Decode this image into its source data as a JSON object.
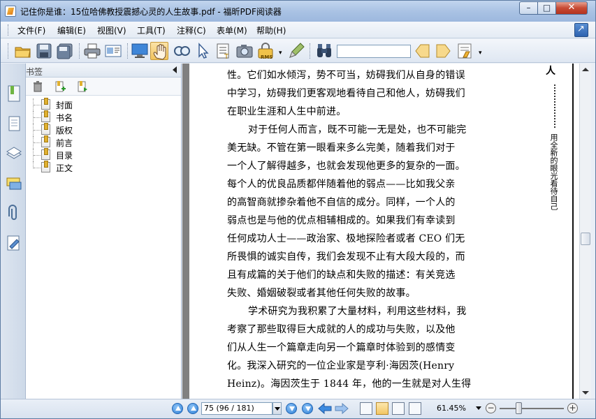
{
  "window": {
    "title": "记住你是谁：15位哈佛教授震撼心灵的人生故事.pdf - 福昕PDF阅读器",
    "min_label": "–",
    "max_label": "□",
    "close_label": "✕"
  },
  "menu": {
    "items": [
      "文件(F)",
      "编辑(E)",
      "视图(V)",
      "工具(T)",
      "注释(C)",
      "表单(M)",
      "帮助(H)"
    ]
  },
  "toolbar": {
    "icons": [
      "open-folder-icon",
      "save-icon",
      "save-as-icon",
      "print-icon",
      "properties-icon",
      "fullscreen-icon",
      "hand-tool-icon",
      "zoom-glass-icon",
      "select-arrow-icon",
      "text-select-icon",
      "snapshot-icon",
      "rms-icon",
      "edit-icon",
      "find-binoculars-icon",
      "find-prev-icon",
      "find-next-icon",
      "highlight-icon"
    ],
    "rms_label": "RMS",
    "find_value": ""
  },
  "bookmarks": {
    "title": "书签",
    "items": [
      "封面",
      "书名",
      "版权",
      "前言",
      "目录",
      "正文"
    ]
  },
  "document": {
    "lines": [
      "性。它们如水倾泻，势不可当，妨碍我们从自身的错误",
      "中学习，妨碍我们更客观地看待自己和他人，妨碍我们",
      "在职业生涯和人生中前进。",
      "对于任何人而言，既不可能一无是处，也不可能完",
      "美无缺。不管在第一眼看来多么完美，随着我们对于",
      "一个人了解得越多，也就会发现他更多的复杂的一面。",
      "每个人的优良品质都伴随着他的弱点——比如我父亲",
      "的高智商就掺杂着他不自信的成分。同样，一个人的",
      "弱点也是与他的优点相辅相成的。如果我们有幸读到",
      "任何成功人士——政治家、极地探险者或者 CEO 们无",
      "所畏惧的诚实自传，我们会发现不止有大段大段的，而",
      "且有成篇的关于他们的缺点和失败的描述：有关竞选",
      "失败、婚姻破裂或者其他任何失败的故事。",
      "学术研究为我积累了大量材料，利用这些材料，我",
      "考察了那些取得巨大成就的人的成功与失败，以及他",
      "们从人生一个篇章走向另一个篇章时体验到的感情变",
      "化。我深入研究的一位企业家是亨利·海因茨(Henry",
      "Heinz)。海因茨生于 1844 年，他的一生就是对人生得"
    ],
    "side_head": "人",
    "side_vertical": "用全新的眼光看待自己"
  },
  "status": {
    "page_field": "75 (96 / 181)",
    "zoom": "61.45%",
    "zoom_level_fraction": 0.3,
    "zoom_minus": "−",
    "zoom_plus": "+"
  },
  "colors": {
    "accent": "#2f7fd6",
    "titlebar": "#a8c1e3",
    "page_background": "#808080"
  }
}
